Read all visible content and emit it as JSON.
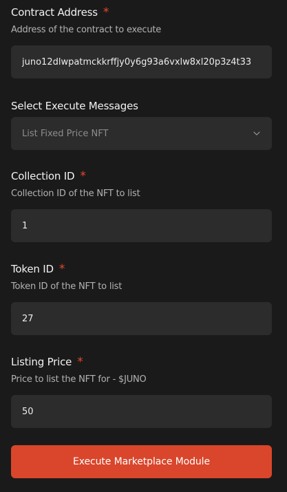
{
  "contract_address": {
    "label": "Contract Address",
    "required_mark": "*",
    "hint": "Address of the contract to execute",
    "value": "juno12dlwpatmckkrffjy0y6g93a6vxlw8xl20p3z4t33"
  },
  "execute_messages": {
    "label": "Select Execute Messages",
    "selected": "List Fixed Price NFT",
    "icon": "chevron-down-icon"
  },
  "collection_id": {
    "label": "Collection ID",
    "required_mark": "*",
    "hint": "Collection ID of the NFT to list",
    "value": "1"
  },
  "token_id": {
    "label": "Token ID",
    "required_mark": "*",
    "hint": "Token ID of the NFT to list",
    "value": "27"
  },
  "listing_price": {
    "label": "Listing Price",
    "required_mark": "*",
    "hint": "Price to list the NFT for - $JUNO",
    "value": "50"
  },
  "submit": {
    "label": "Execute Marketplace Module"
  },
  "colors": {
    "background": "#1a1a1a",
    "input_background": "#2c2c2c",
    "accent": "#d9462b",
    "required": "#e8482a"
  }
}
